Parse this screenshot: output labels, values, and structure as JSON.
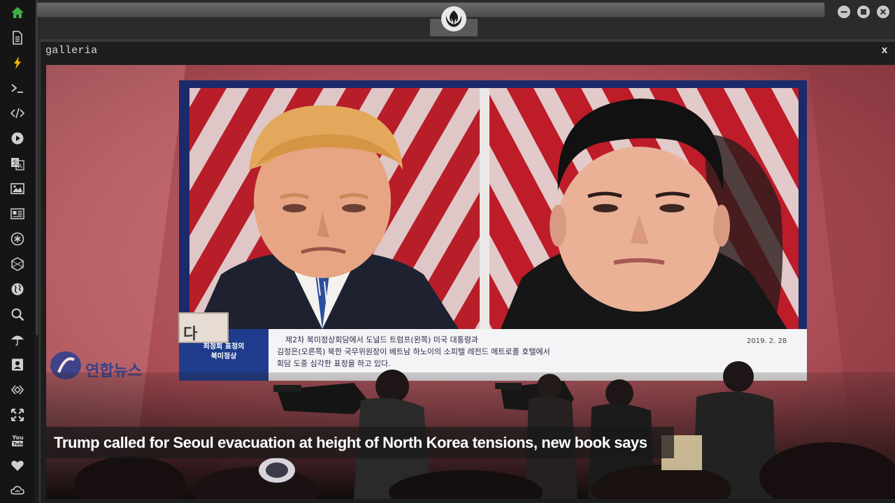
{
  "sidebar": {
    "items": [
      {
        "name": "home-icon",
        "color": "#3fae49"
      },
      {
        "name": "document-icon"
      },
      {
        "name": "lightning-icon",
        "color": "#f2b705"
      },
      {
        "name": "terminal-icon"
      },
      {
        "name": "code-icon"
      },
      {
        "name": "play-icon"
      },
      {
        "name": "translate-icon"
      },
      {
        "name": "image-icon"
      },
      {
        "name": "news-icon"
      },
      {
        "name": "asterisk-icon"
      },
      {
        "name": "hexagon-icon"
      },
      {
        "name": "globe-icon"
      },
      {
        "name": "search-icon"
      },
      {
        "name": "umbrella-icon"
      },
      {
        "name": "contact-icon"
      },
      {
        "name": "network-icon"
      },
      {
        "name": "expand-icon"
      },
      {
        "name": "youtube-icon"
      },
      {
        "name": "heart-icon"
      },
      {
        "name": "cloud-icon"
      }
    ]
  },
  "window": {
    "logo": "rebel-alliance-icon",
    "controls": [
      "minimize-icon",
      "maximize-icon",
      "close-icon"
    ]
  },
  "panel": {
    "title": "galleria",
    "close_label": "x"
  },
  "photo": {
    "caption": "Trump called for Seoul evacuation at height of North Korea tensions, new book says",
    "news_agency": "연합뉴스",
    "banner_tag": "다",
    "banner_sub_1": "최정회 표정의",
    "banner_sub_2": "북미정상",
    "banner_line_1": "제2차 북미정상회담에서 도널드 트럼프(왼쪽) 미국 대통령과",
    "banner_line_2": "김정은(오른쪽) 북한 국무위원장이 베트남 하노이의 소피텔 레전드 메트로폴 호텔에서",
    "banner_line_3": "회담 도중 심각한 표정을 하고 있다.",
    "banner_date": "2019. 2. 28"
  },
  "colors": {
    "sidebar_bg": "#151515",
    "icon": "#cfcfcf",
    "accent_green": "#3fae49",
    "accent_yellow": "#f2b705"
  }
}
